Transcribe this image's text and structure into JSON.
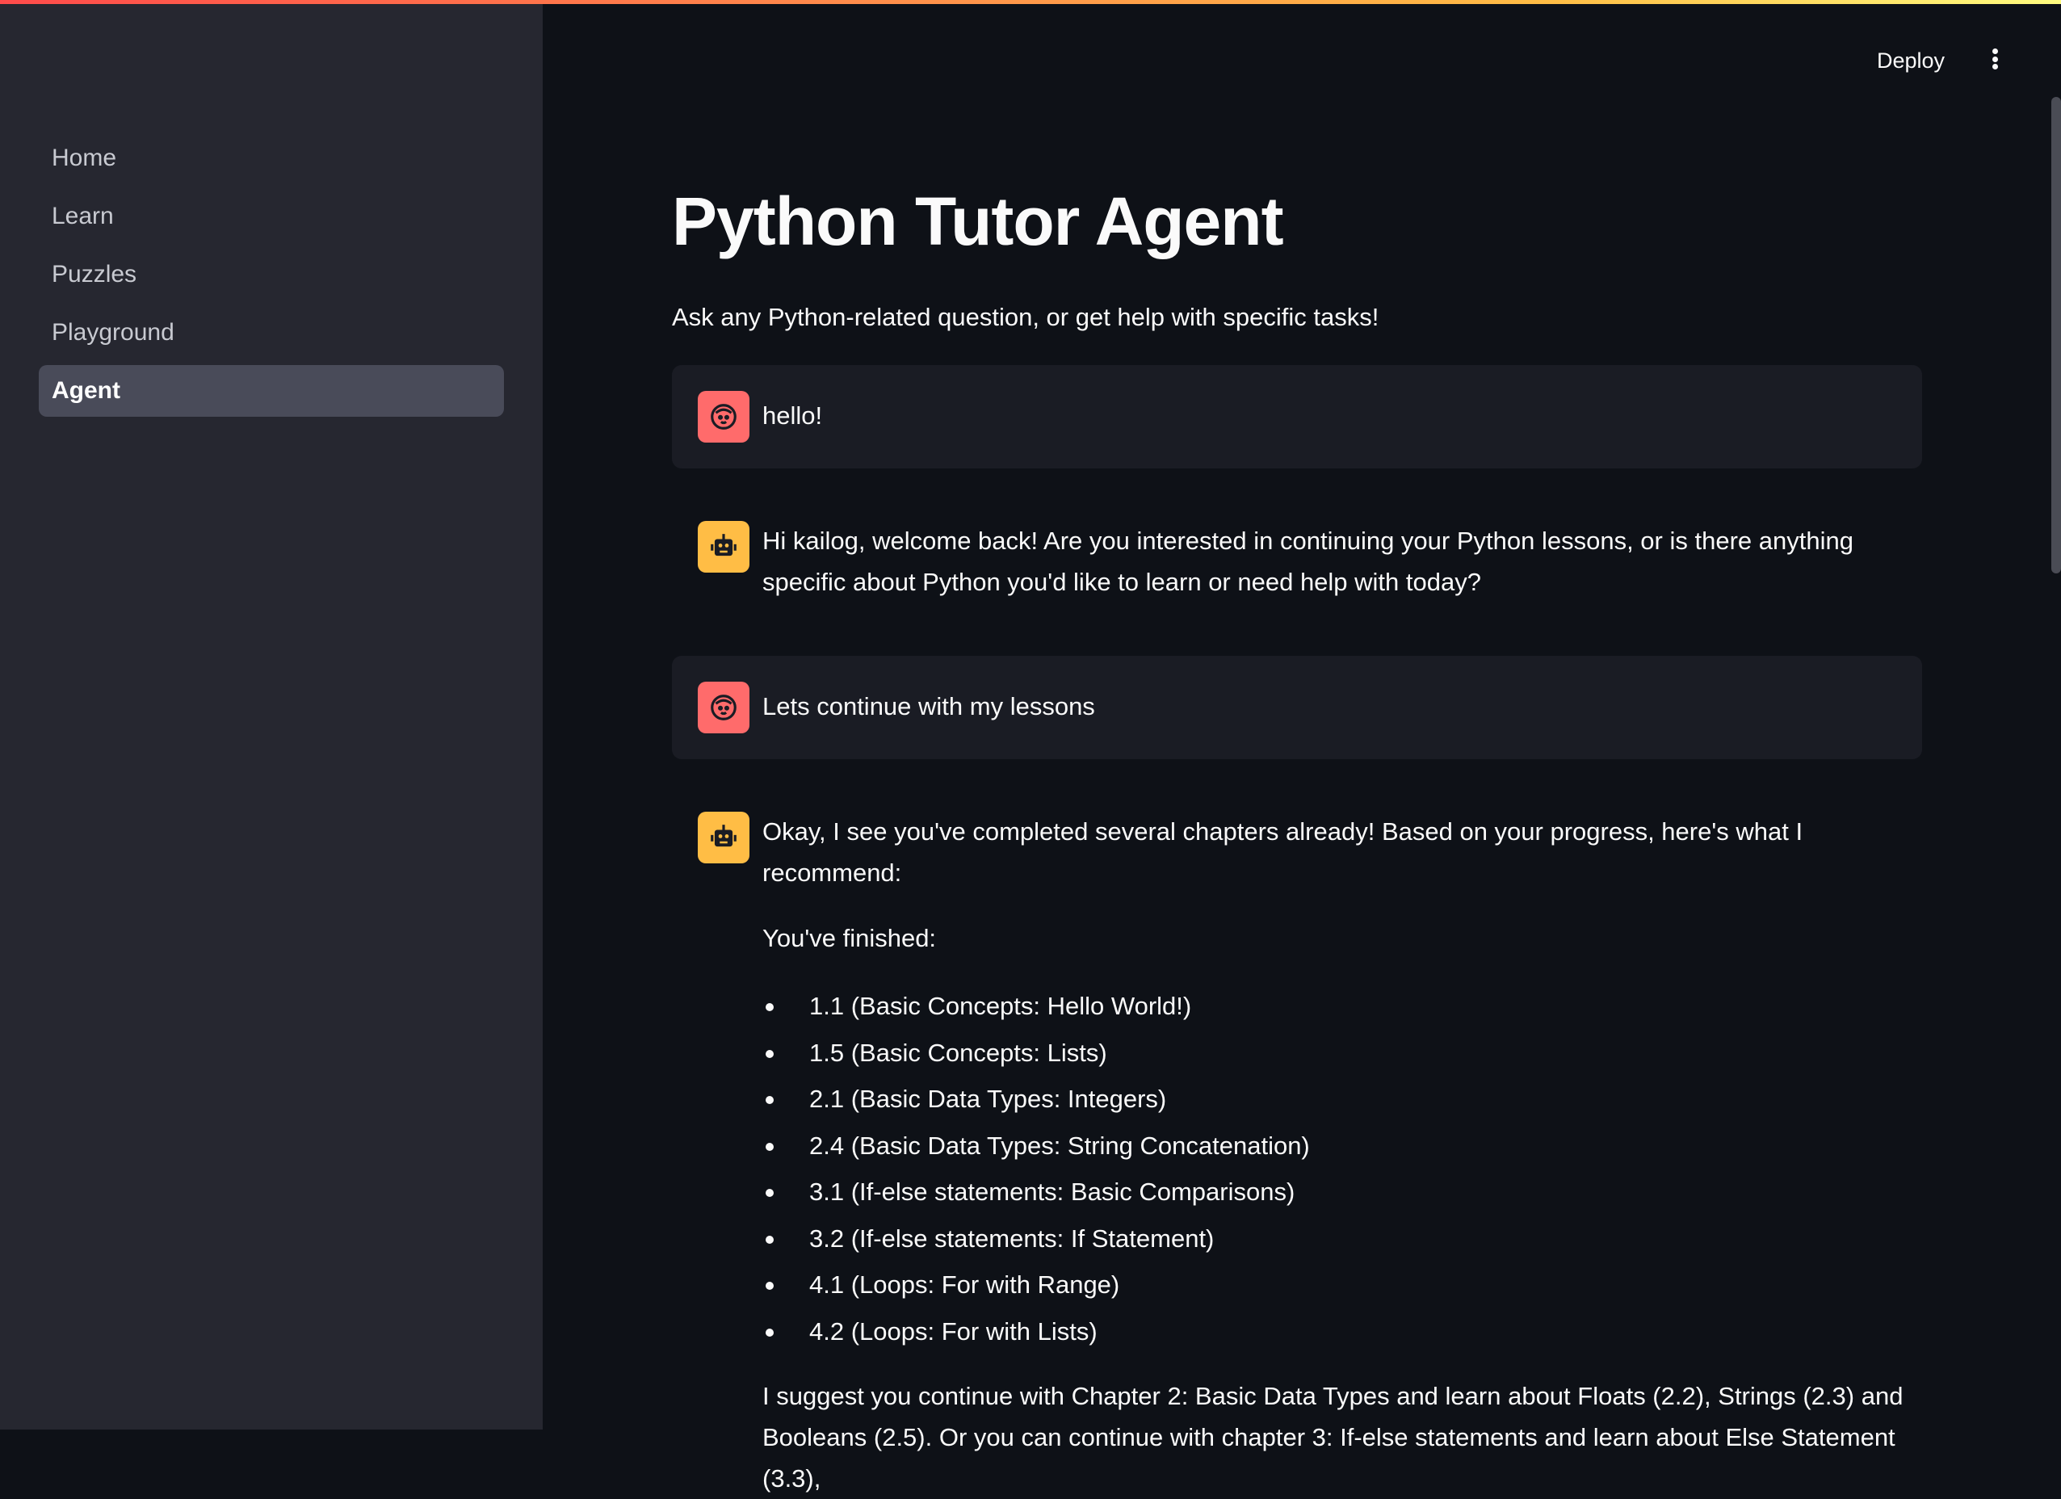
{
  "sidebar": {
    "items": [
      {
        "label": "Home",
        "active": false
      },
      {
        "label": "Learn",
        "active": false
      },
      {
        "label": "Puzzles",
        "active": false
      },
      {
        "label": "Playground",
        "active": false
      },
      {
        "label": "Agent",
        "active": true
      }
    ]
  },
  "header": {
    "deploy_label": "Deploy",
    "menu_icon": "kebab-menu-icon"
  },
  "page": {
    "title": "Python Tutor Agent",
    "subtitle": "Ask any Python-related question, or get help with specific tasks!"
  },
  "chat": {
    "messages": [
      {
        "role": "user",
        "avatar_icon": "user-face-icon",
        "text": "hello!"
      },
      {
        "role": "assistant",
        "avatar_icon": "robot-icon",
        "text": "Hi kailog, welcome back! Are you interested in continuing your Python lessons, or is there anything specific about Python you'd like to learn or need help with today?"
      },
      {
        "role": "user",
        "avatar_icon": "user-face-icon",
        "text": "Lets continue with my lessons"
      },
      {
        "role": "assistant",
        "avatar_icon": "robot-icon",
        "intro": "Okay, I see you've completed several chapters already! Based on your progress, here's what I recommend:",
        "finished_label": "You've finished:",
        "finished": [
          "1.1 (Basic Concepts: Hello World!)",
          "1.5 (Basic Concepts: Lists)",
          "2.1 (Basic Data Types: Integers)",
          "2.4 (Basic Data Types: String Concatenation)",
          "3.1 (If-else statements: Basic Comparisons)",
          "3.2 (If-else statements: If Statement)",
          "4.1 (Loops: For with Range)",
          "4.2 (Loops: For with Lists)"
        ],
        "suggestion": "I suggest you continue with Chapter 2: Basic Data Types and learn about Floats (2.2), Strings (2.3) and Booleans (2.5). Or you can continue with chapter 3: If-else statements and learn about Else Statement (3.3),"
      }
    ]
  },
  "colors": {
    "background": "#0e1117",
    "sidebar": "#262730",
    "user_avatar": "#ff6b6b",
    "bot_avatar": "#ffbd45",
    "active_nav": "#494b59"
  }
}
